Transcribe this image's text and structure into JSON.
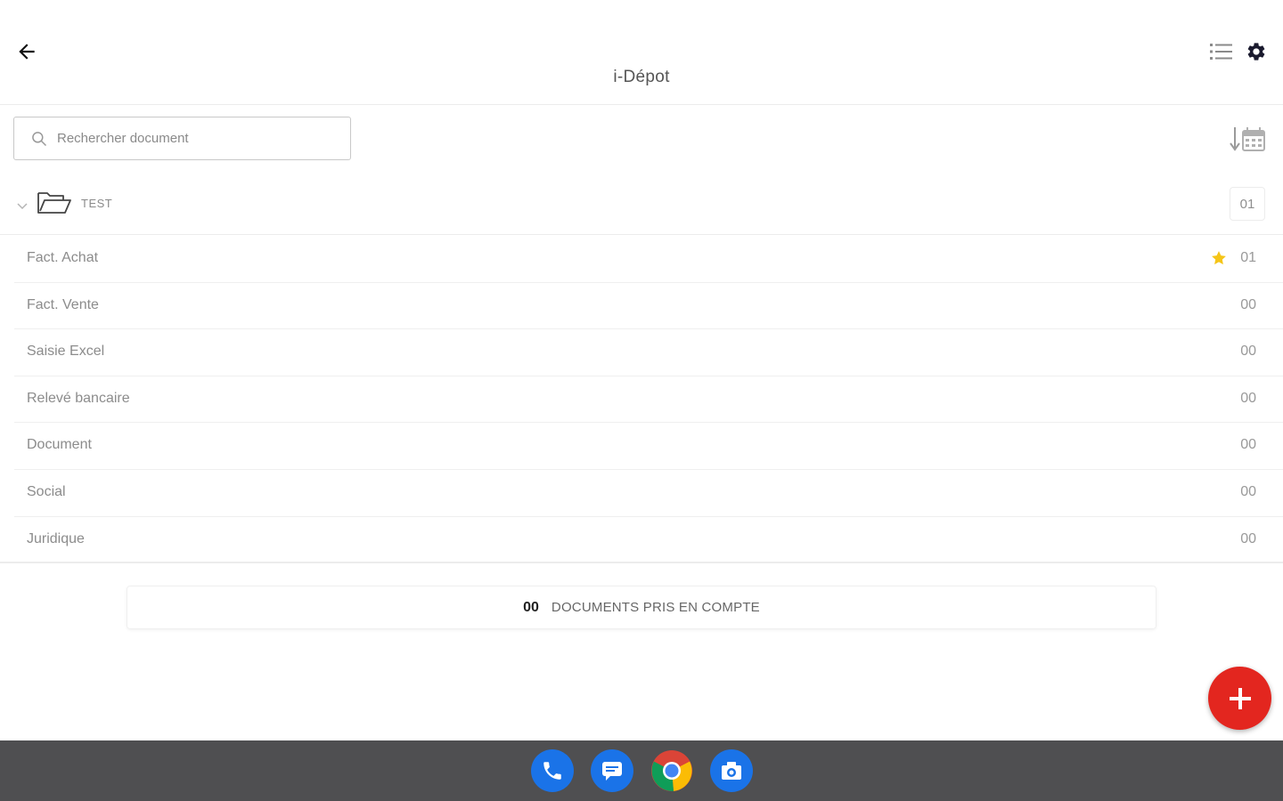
{
  "header": {
    "title": "i-Dépot",
    "back_icon": "arrow-left-icon",
    "list_icon": "list-view-icon",
    "settings_icon": "gear-icon"
  },
  "search": {
    "placeholder": "Rechercher document",
    "value": "",
    "icon": "search-icon"
  },
  "sort": {
    "icon": "sort-by-date-icon"
  },
  "folder": {
    "name": "TEST",
    "count": "01",
    "expanded": true,
    "icon": "folder-open-icon"
  },
  "categories": [
    {
      "label": "Fact. Achat",
      "count": "01",
      "starred": true
    },
    {
      "label": "Fact. Vente",
      "count": "00",
      "starred": false
    },
    {
      "label": "Saisie Excel",
      "count": "00",
      "starred": false
    },
    {
      "label": "Relevé bancaire",
      "count": "00",
      "starred": false
    },
    {
      "label": "Document",
      "count": "00",
      "starred": false
    },
    {
      "label": "Social",
      "count": "00",
      "starred": false
    },
    {
      "label": "Juridique",
      "count": "00",
      "starred": false
    }
  ],
  "summary": {
    "count": "00",
    "label": "DOCUMENTS PRIS EN COMPTE"
  },
  "fab": {
    "icon": "plus-icon"
  },
  "taskbar": {
    "apps": [
      "phone-icon",
      "messages-icon",
      "chrome-icon",
      "camera-icon"
    ]
  },
  "colors": {
    "accent_red": "#e3261f",
    "star_yellow": "#f5c518",
    "taskbar": "#4f4f51",
    "dock_blue": "#1a73e8"
  }
}
